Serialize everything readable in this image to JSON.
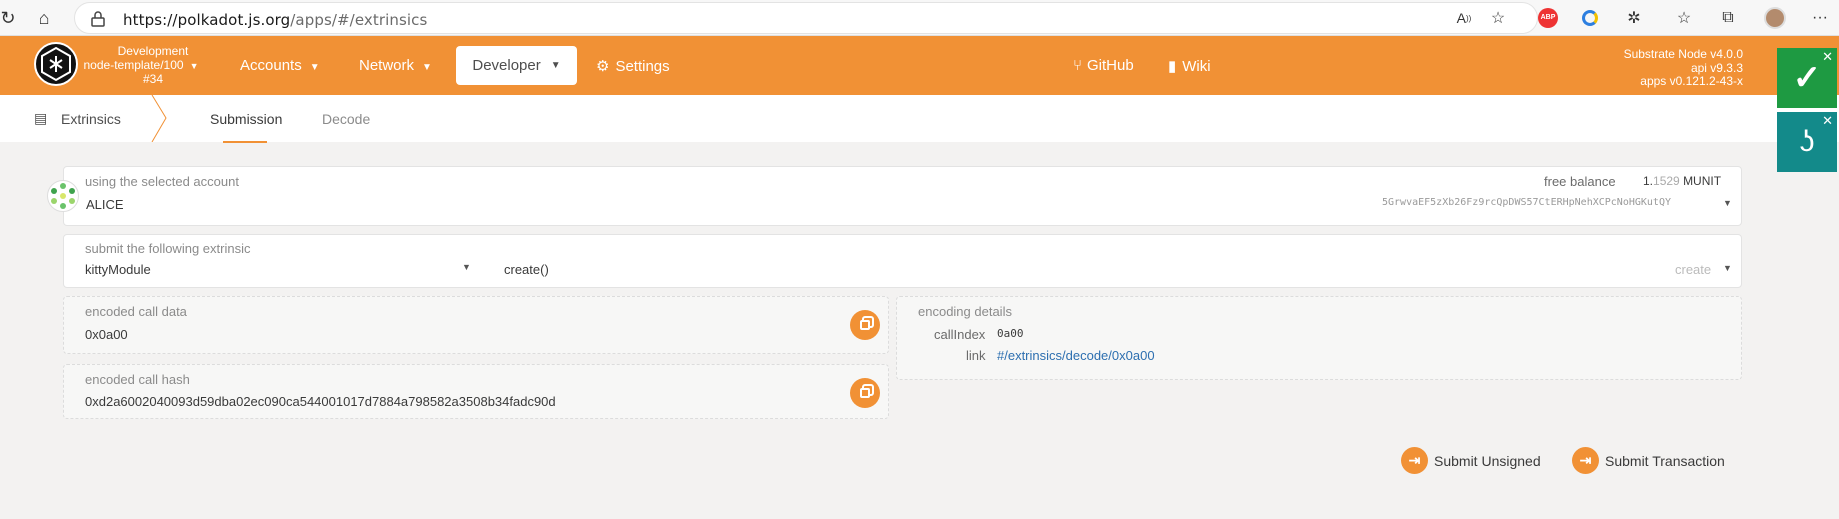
{
  "browser": {
    "url_host": "https://polkadot.js.org",
    "url_path": "/apps/#/extrinsics",
    "ext_abp": "ABP"
  },
  "chain": {
    "name": "Development",
    "node": "node-template/100",
    "block": "#34"
  },
  "nav": {
    "accounts": "Accounts",
    "network": "Network",
    "developer": "Developer",
    "settings": "Settings",
    "github": "GitHub",
    "wiki": "Wiki"
  },
  "version": {
    "node": "Substrate Node v4.0.0",
    "api": "api v9.3.3",
    "apps": "apps v0.121.2-43-x"
  },
  "subnav": {
    "section": "Extrinsics",
    "tabs": [
      "Submission",
      "Decode"
    ]
  },
  "account": {
    "label": "using the selected account",
    "name": "ALICE",
    "free_balance_label": "free balance",
    "balance_int": "1.",
    "balance_dec": "1529",
    "balance_unit": "MUNIT",
    "address": "5GrwvaEF5zXb26Fz9rcQpDWS57CtERHpNehXCPcNoHGKutQY"
  },
  "extrinsic": {
    "label": "submit the following extrinsic",
    "module": "kittyModule",
    "call": "create()",
    "method": "create"
  },
  "encoded": {
    "call_data_label": "encoded call data",
    "call_data": "0x0a00",
    "call_hash_label": "encoded call hash",
    "call_hash": "0xd2a6002040093d59dba02ec090ca544001017d7884a798582a3508b34fadc90d"
  },
  "encoding": {
    "label": "encoding details",
    "call_index_label": "callIndex",
    "call_index": "0a00",
    "link_label": "link",
    "link": "#/extrinsics/decode/0x0a00"
  },
  "actions": {
    "submit_unsigned": "Submit Unsigned",
    "submit_transaction": "Submit Transaction"
  },
  "colors": {
    "accent": "#f19135",
    "ext_green": "#1e9a42",
    "ext_teal": "#138a8a"
  }
}
